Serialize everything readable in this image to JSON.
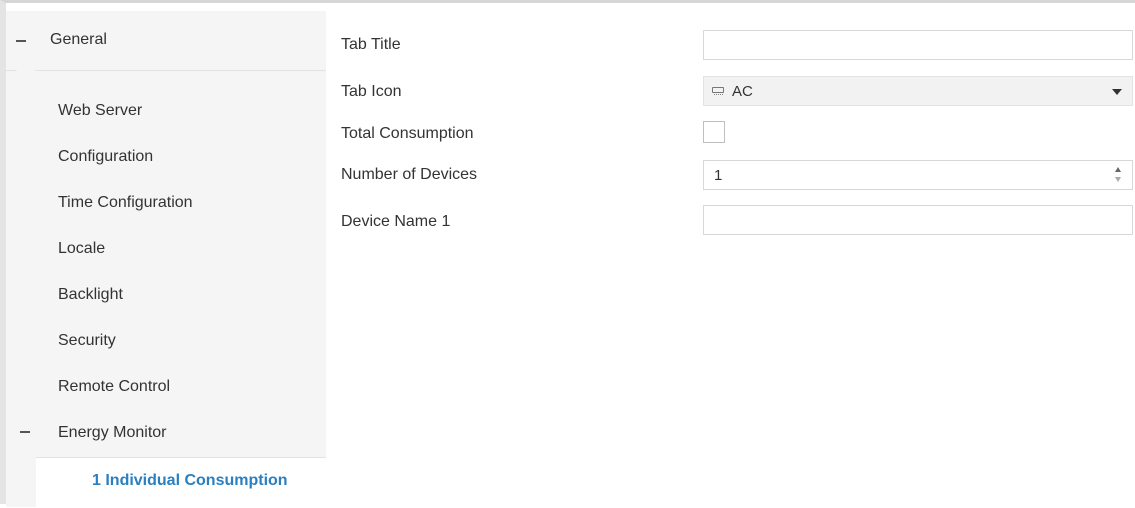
{
  "sidebar": {
    "general": {
      "label": "General",
      "expander": "minus-icon"
    },
    "items": [
      {
        "label": "Web Server"
      },
      {
        "label": "Configuration"
      },
      {
        "label": "Time Configuration"
      },
      {
        "label": "Locale"
      },
      {
        "label": "Backlight"
      },
      {
        "label": "Security"
      },
      {
        "label": "Remote Control"
      }
    ],
    "energy_monitor": {
      "label": "Energy Monitor",
      "expander": "minus-icon"
    },
    "selected_sub": {
      "label": "1 Individual Consumption",
      "color": "#2a7fc0"
    }
  },
  "form": {
    "tab_title": {
      "label": "Tab Title",
      "value": ""
    },
    "tab_icon": {
      "label": "Tab Icon",
      "value": "AC",
      "icon": "ac-unit-icon"
    },
    "total_consumption": {
      "label": "Total Consumption",
      "checked": false
    },
    "number_of_devices": {
      "label": "Number of Devices",
      "value": "1"
    },
    "device_name_1": {
      "label": "Device Name 1",
      "value": ""
    }
  }
}
